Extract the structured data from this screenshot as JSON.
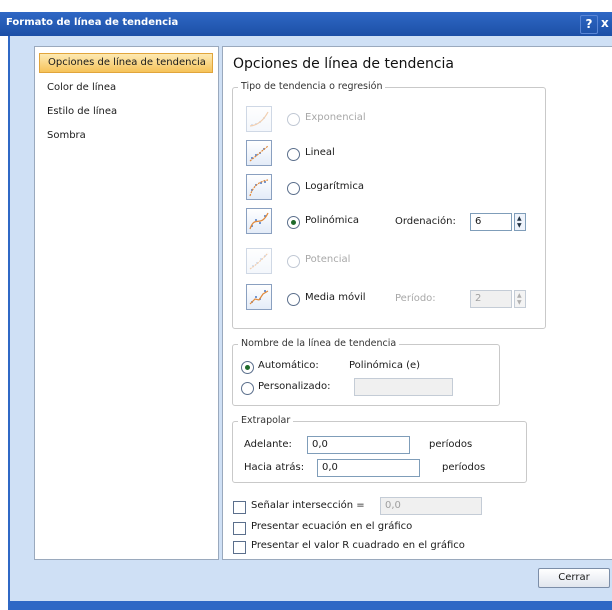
{
  "window": {
    "title": "Formato de línea de tendencia",
    "help_glyph": "?",
    "close_glyph": "x"
  },
  "sidebar": {
    "items": [
      {
        "label": "Opciones de línea de tendencia",
        "selected": true
      },
      {
        "label": "Color de línea",
        "selected": false
      },
      {
        "label": "Estilo de línea",
        "selected": false
      },
      {
        "label": "Sombra",
        "selected": false
      }
    ]
  },
  "panel": {
    "heading": "Opciones de línea de tendencia",
    "type_group": {
      "legend": "Tipo de tendencia o regresión",
      "options": [
        {
          "key": "exponential",
          "label": "Exponencial",
          "enabled": false,
          "selected": false
        },
        {
          "key": "linear",
          "label": "Lineal",
          "enabled": true,
          "selected": false
        },
        {
          "key": "logarithmic",
          "label": "Logarítmica",
          "enabled": true,
          "selected": false
        },
        {
          "key": "polynomial",
          "label": "Polinómica",
          "enabled": true,
          "selected": true
        },
        {
          "key": "power",
          "label": "Potencial",
          "enabled": false,
          "selected": false
        },
        {
          "key": "moving_average",
          "label": "Media móvil",
          "enabled": true,
          "selected": false
        }
      ],
      "order_label": "Ordenación:",
      "order_value": "6",
      "period_label": "Período:",
      "period_value": "2"
    },
    "name_group": {
      "legend": "Nombre de la línea de tendencia",
      "automatic_label": "Automático:",
      "automatic_value": "Polinómica (e)",
      "custom_label": "Personalizado:",
      "custom_value": "",
      "selected": "automatic"
    },
    "extrapolate_group": {
      "legend": "Extrapolar",
      "forward_label": "Adelante:",
      "forward_value": "0,0",
      "forward_unit": "períodos",
      "backward_label": "Hacia atrás:",
      "backward_value": "0,0",
      "backward_unit": "períodos"
    },
    "checkboxes": {
      "intercept_label": "Señalar intersección =",
      "intercept_value": "0,0",
      "intercept_checked": false,
      "equation_label": "Presentar ecuación en el gráfico",
      "equation_checked": false,
      "rsquared_label": "Presentar el valor R cuadrado en el gráfico",
      "rsquared_checked": false
    }
  },
  "footer": {
    "close_label": "Cerrar"
  },
  "colors": {
    "title_bar": "#2f68c5",
    "frame": "#cfe0f5",
    "selection": "#f6c35a"
  }
}
